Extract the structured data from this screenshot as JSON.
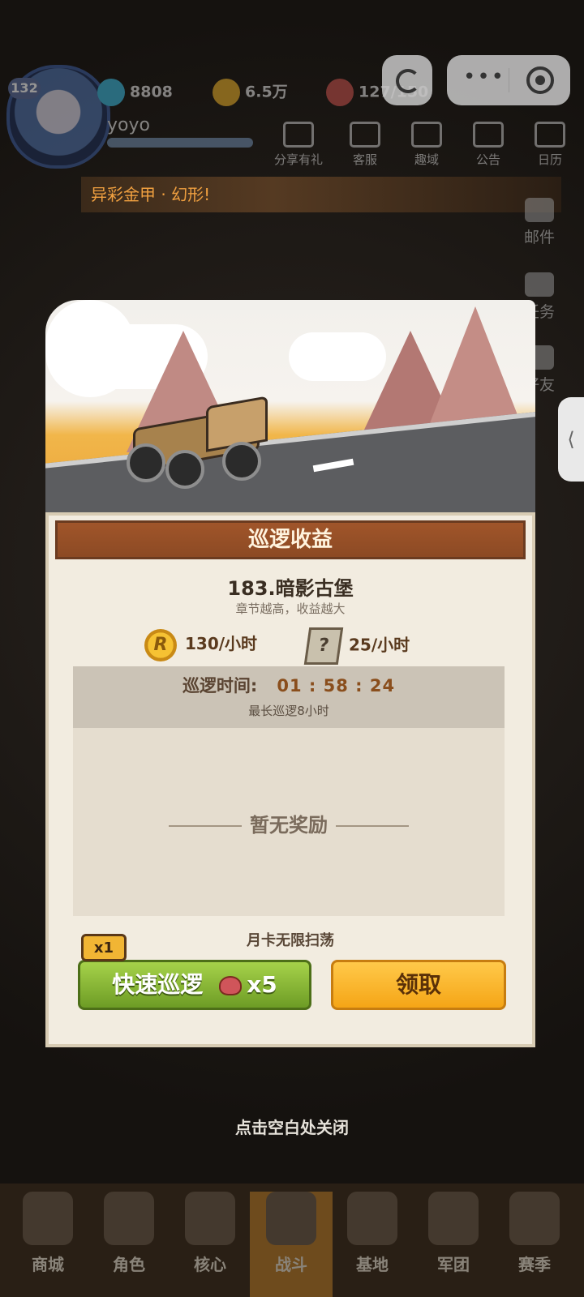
{
  "hud": {
    "level": "132",
    "gems": "8808",
    "coins": "6.5万",
    "stamina": "127/150",
    "username": "yoyo",
    "buttons": [
      "分享有礼",
      "客服",
      "趣域",
      "公告",
      "日历"
    ],
    "notice": "异彩金甲 · 幻形!",
    "side_right": [
      "邮件",
      "任务",
      "好友"
    ]
  },
  "dialog": {
    "title": "巡逻收益",
    "chapter": "183.暗影古堡",
    "chapter_sub": "章节越高，收益越大",
    "coin_rate": "130/小时",
    "map_rate": "25/小时",
    "time_label": "巡逻时间:",
    "time_value": "01 : 58 : 24",
    "time_max": "最长巡逻8小时",
    "no_reward": "暂无奖励",
    "monthly": "月卡无限扫荡",
    "badge": "x1",
    "fast_label": "快速巡逻",
    "fast_cost": "x5",
    "claim_label": "领取"
  },
  "close_hint": "点击空白处关闭",
  "nav": [
    "商城",
    "角色",
    "核心",
    "战斗",
    "基地",
    "军团",
    "赛季"
  ]
}
